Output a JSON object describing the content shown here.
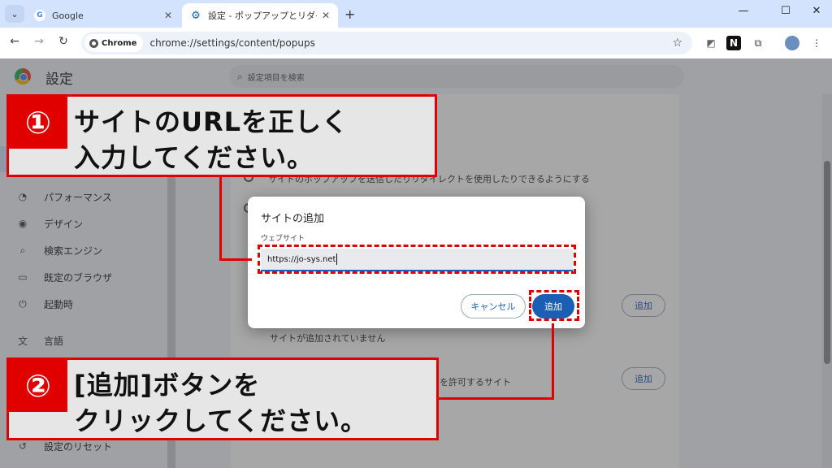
{
  "tabs": [
    {
      "title": "Google",
      "favicon": "google-g-icon"
    },
    {
      "title": "設定 - ポップアップとリダイレクト",
      "favicon": "gear-icon"
    }
  ],
  "toolbar": {
    "chip_label": "Chrome",
    "url": "chrome://settings/content/popups"
  },
  "settings": {
    "title": "設定",
    "search_placeholder": "設定項目を検索",
    "sidebar": [
      {
        "label": "パフォーマンス",
        "icon": "speedometer-icon"
      },
      {
        "label": "デザイン",
        "icon": "palette-icon"
      },
      {
        "label": "検索エンジン",
        "icon": "search-icon"
      },
      {
        "label": "既定のブラウザ",
        "icon": "browser-icon"
      },
      {
        "label": "起動時",
        "icon": "power-icon"
      },
      {
        "label": "言語",
        "icon": "translate-icon"
      },
      {
        "label": "設定のリセット",
        "icon": "reset-icon"
      }
    ],
    "content": {
      "line_a": "サイトのポップアップを送信したりリダイレクトを使用したりできるようにする",
      "no_sites": "サイトが追加されていません",
      "line_b": "ポップアップの送信やリダイレクトの使用を許可するサイト",
      "add_label": "追加"
    }
  },
  "dialog": {
    "title": "サイトの追加",
    "field_label": "ウェブサイト",
    "field_value": "https://jo-sys.net",
    "cancel_label": "キャンセル",
    "add_label": "追加"
  },
  "callouts": [
    {
      "number": "①",
      "line1": "サイトのURLを正しく",
      "line2": "入力してください。"
    },
    {
      "number": "②",
      "line1": "[追加]ボタンを",
      "line2": "クリックしてください。"
    }
  ],
  "colors": {
    "accent": "#1a5fb4",
    "annotation": "#e00000"
  }
}
